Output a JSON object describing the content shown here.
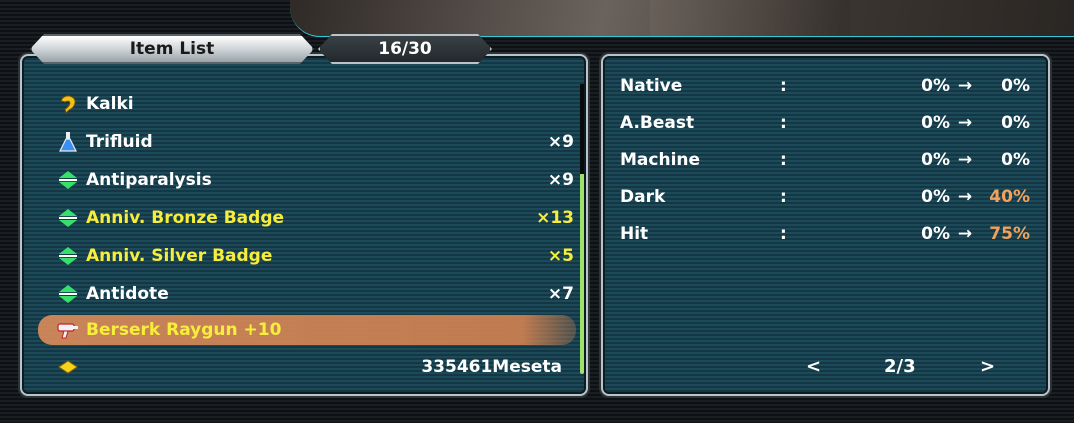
{
  "header": {
    "title": "Item List",
    "count": "16/30"
  },
  "items": [
    {
      "name": "Kalki",
      "qty": "",
      "icon": "claw-icon",
      "color": "white"
    },
    {
      "name": "Trifluid",
      "qty": "×9",
      "icon": "flask-icon",
      "color": "white"
    },
    {
      "name": "Antiparalysis",
      "qty": "×9",
      "icon": "capsule-icon",
      "color": "white"
    },
    {
      "name": "Anniv. Bronze Badge",
      "qty": "×13",
      "icon": "capsule-icon",
      "color": "yellow"
    },
    {
      "name": "Anniv. Silver Badge",
      "qty": "×5",
      "icon": "capsule-icon",
      "color": "yellow"
    },
    {
      "name": "Antidote",
      "qty": "×7",
      "icon": "capsule-icon",
      "color": "white"
    },
    {
      "name": "Berserk Raygun +10",
      "qty": "",
      "icon": "raygun-icon",
      "color": "yellow",
      "selected": true
    }
  ],
  "meseta": {
    "label": "335461Meseta",
    "icon": "meseta-icon"
  },
  "stats": [
    {
      "name": "Native",
      "colon": ":",
      "from": "0%",
      "arrow": "→",
      "to": "0%",
      "highlight": false
    },
    {
      "name": "A.Beast",
      "colon": ":",
      "from": "0%",
      "arrow": "→",
      "to": "0%",
      "highlight": false
    },
    {
      "name": "Machine",
      "colon": ":",
      "from": "0%",
      "arrow": "→",
      "to": "0%",
      "highlight": false
    },
    {
      "name": "Dark",
      "colon": ":",
      "from": "0%",
      "arrow": "→",
      "to": "40%",
      "highlight": true
    },
    {
      "name": "Hit",
      "colon": ":",
      "from": "0%",
      "arrow": "→",
      "to": "75%",
      "highlight": true
    }
  ],
  "pager": {
    "prev": "<",
    "page": "2/3",
    "next": ">"
  },
  "colors": {
    "panel": "#1d4a59",
    "yellow_text": "#f6ee3a",
    "orange_text": "#f2a25a",
    "selection": "#dc8c5a"
  }
}
